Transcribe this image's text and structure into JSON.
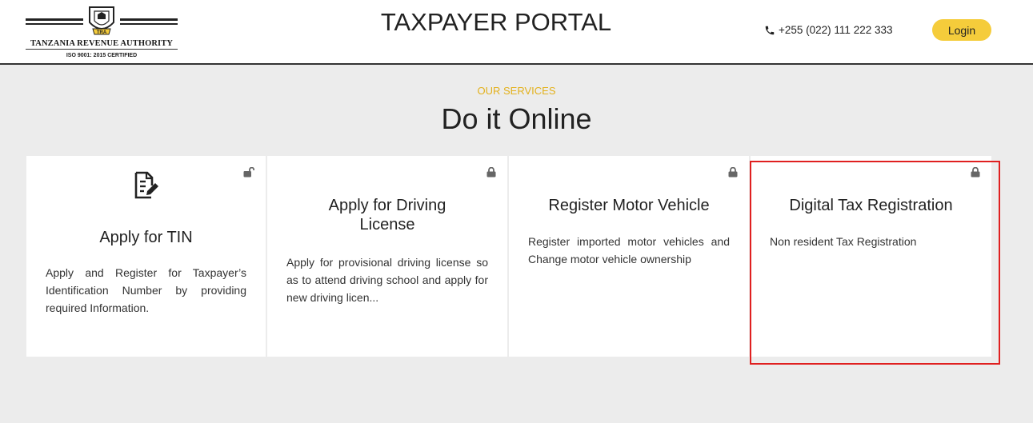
{
  "header": {
    "logo_org_name": "TANZANIA REVENUE AUTHORITY",
    "logo_cert": "ISO 9001: 2015 CERTIFIED",
    "logo_badge": "TRA",
    "title": "TAXPAYER PORTAL",
    "phone": "+255 (022) 111 222 333",
    "login_label": "Login",
    "accent_color": "#f5cc3b"
  },
  "services": {
    "subtitle": "OUR SERVICES",
    "title": "Do it Online",
    "cards": [
      {
        "title": "Apply for TIN",
        "description": "Apply and Register for Taxpayer’s Identification Number by providing required Information.",
        "icon": "document-edit-icon",
        "lock": "unlocked"
      },
      {
        "title": "Apply for Driving License",
        "description": "Apply for provisional driving license so as to attend driving school and apply for new driving licen...",
        "lock": "locked"
      },
      {
        "title": "Register Motor Vehicle",
        "description": "Register imported motor vehicles and Change motor vehicle ownership",
        "lock": "locked"
      },
      {
        "title": "Digital Tax Registration",
        "description": "Non resident Tax Registration",
        "lock": "locked",
        "highlighted": true
      }
    ]
  },
  "highlight_color": "#e02020"
}
